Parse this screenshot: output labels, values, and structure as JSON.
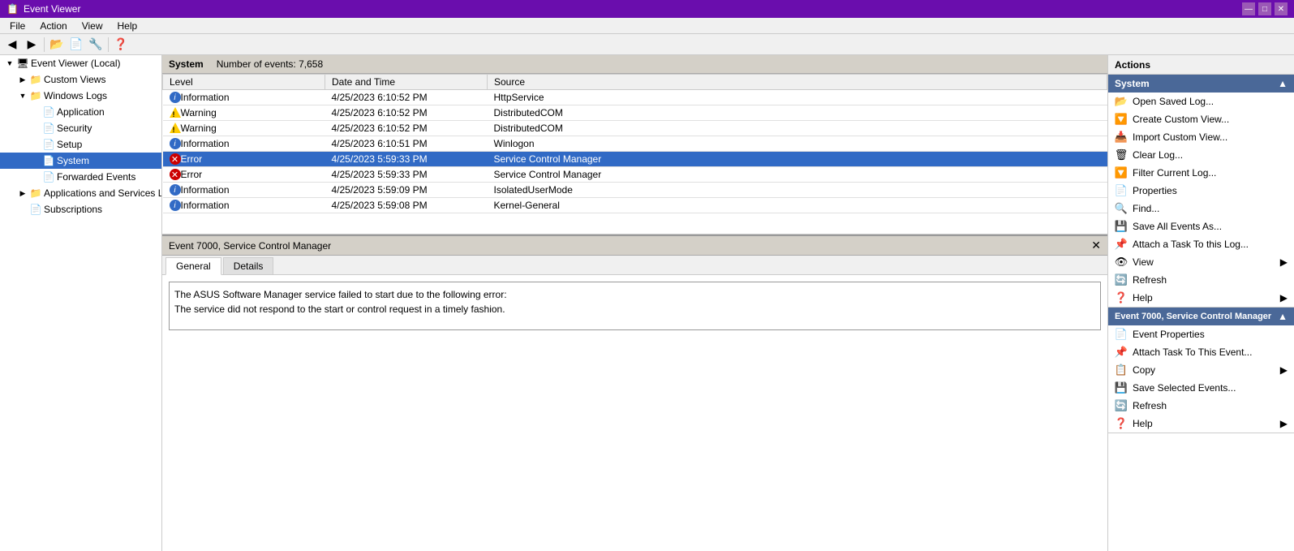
{
  "titleBar": {
    "title": "Event Viewer",
    "icon": "📋",
    "controls": [
      "—",
      "□",
      "✕"
    ]
  },
  "menuBar": {
    "items": [
      "File",
      "Action",
      "View",
      "Help"
    ]
  },
  "sidebar": {
    "rootLabel": "Event Viewer (Local)",
    "items": [
      {
        "id": "custom-views",
        "label": "Custom Views",
        "indent": 1,
        "hasExpand": true,
        "expanded": false
      },
      {
        "id": "windows-logs",
        "label": "Windows Logs",
        "indent": 1,
        "hasExpand": true,
        "expanded": true
      },
      {
        "id": "application",
        "label": "Application",
        "indent": 2,
        "hasExpand": false
      },
      {
        "id": "security",
        "label": "Security",
        "indent": 2,
        "hasExpand": false
      },
      {
        "id": "setup",
        "label": "Setup",
        "indent": 2,
        "hasExpand": false
      },
      {
        "id": "system",
        "label": "System",
        "indent": 2,
        "hasExpand": false,
        "selected": true
      },
      {
        "id": "forwarded-events",
        "label": "Forwarded Events",
        "indent": 2,
        "hasExpand": false
      },
      {
        "id": "apps-services",
        "label": "Applications and Services Lo",
        "indent": 1,
        "hasExpand": true,
        "expanded": false
      },
      {
        "id": "subscriptions",
        "label": "Subscriptions",
        "indent": 1,
        "hasExpand": false
      }
    ]
  },
  "logHeader": {
    "name": "System",
    "eventCount": "Number of events: 7,658"
  },
  "tableColumns": [
    "Level",
    "Date and Time",
    "Source"
  ],
  "events": [
    {
      "level": "Information",
      "levelType": "info",
      "dateTime": "4/25/2023 6:10:52 PM",
      "source": "HttpService"
    },
    {
      "level": "Warning",
      "levelType": "warning",
      "dateTime": "4/25/2023 6:10:52 PM",
      "source": "DistributedCOM"
    },
    {
      "level": "Warning",
      "levelType": "warning",
      "dateTime": "4/25/2023 6:10:52 PM",
      "source": "DistributedCOM"
    },
    {
      "level": "Information",
      "levelType": "info",
      "dateTime": "4/25/2023 6:10:51 PM",
      "source": "Winlogon"
    },
    {
      "level": "Error",
      "levelType": "error",
      "dateTime": "4/25/2023 5:59:33 PM",
      "source": "Service Control Manager",
      "selected": true
    },
    {
      "level": "Error",
      "levelType": "error",
      "dateTime": "4/25/2023 5:59:33 PM",
      "source": "Service Control Manager"
    },
    {
      "level": "Information",
      "levelType": "info",
      "dateTime": "4/25/2023 5:59:09 PM",
      "source": "IsolatedUserMode"
    },
    {
      "level": "Information",
      "levelType": "info",
      "dateTime": "4/25/2023 5:59:08 PM",
      "source": "Kernel-General"
    }
  ],
  "detailPanel": {
    "title": "Event 7000, Service Control Manager",
    "tabs": [
      "General",
      "Details"
    ],
    "activeTab": "General",
    "content": "The ASUS Software Manager service failed to start due to the following error:\nThe service did not respond to the start or control request in a timely fashion."
  },
  "actionsPanel": {
    "title": "Actions",
    "systemSection": {
      "label": "System",
      "items": [
        {
          "icon": "📂",
          "label": "Open Saved Log..."
        },
        {
          "icon": "🔽",
          "label": "Create Custom View..."
        },
        {
          "icon": "📥",
          "label": "Import Custom View..."
        },
        {
          "icon": "🗑",
          "label": "Clear Log..."
        },
        {
          "icon": "🔽",
          "label": "Filter Current Log..."
        },
        {
          "icon": "📄",
          "label": "Properties"
        },
        {
          "icon": "🔍",
          "label": "Find..."
        },
        {
          "icon": "💾",
          "label": "Save All Events As..."
        },
        {
          "icon": "📌",
          "label": "Attach a Task To this Log..."
        },
        {
          "icon": "👁",
          "label": "View",
          "hasArrow": true
        },
        {
          "icon": "🔄",
          "label": "Refresh"
        },
        {
          "icon": "❓",
          "label": "Help",
          "hasArrow": true
        }
      ]
    },
    "eventSection": {
      "label": "Event 7000, Service Control Manager",
      "items": [
        {
          "icon": "📄",
          "label": "Event Properties"
        },
        {
          "icon": "📌",
          "label": "Attach Task To This Event..."
        },
        {
          "icon": "📋",
          "label": "Copy",
          "hasArrow": true
        },
        {
          "icon": "💾",
          "label": "Save Selected Events..."
        },
        {
          "icon": "🔄",
          "label": "Refresh"
        },
        {
          "icon": "❓",
          "label": "Help",
          "hasArrow": true
        }
      ]
    }
  }
}
